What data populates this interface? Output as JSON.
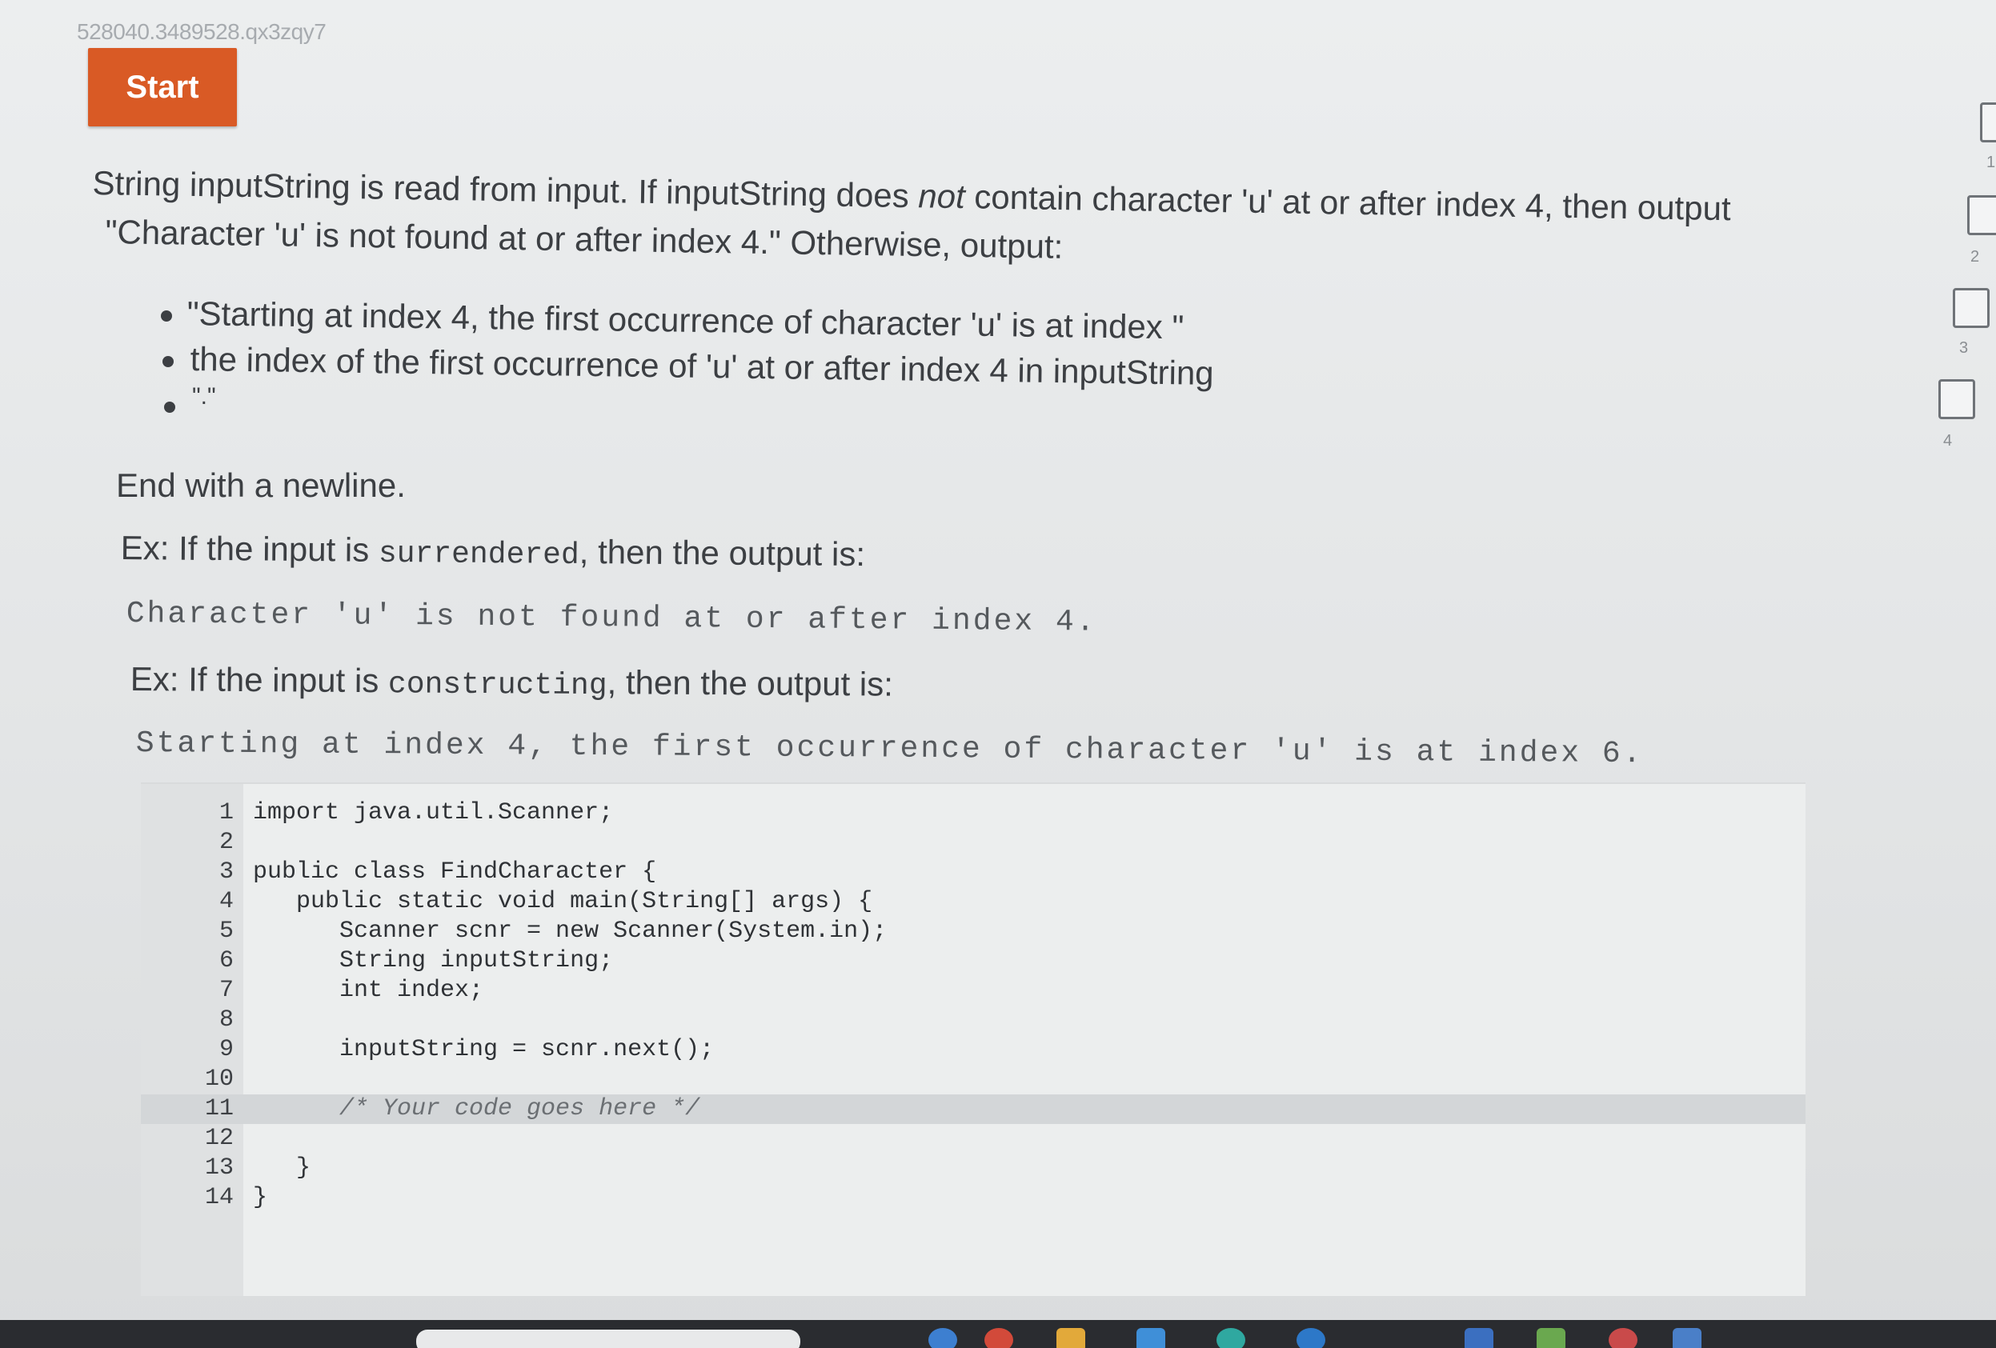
{
  "activity_id": "528040.3489528.qx3zqy7",
  "start_button": {
    "label": "Start",
    "color": "#d95a25"
  },
  "prompt": {
    "line1_a": "String inputString is read from input. If inputString does ",
    "line1_em": "not",
    "line1_b": " contain character 'u' at or after index 4, then output",
    "line2": "\"Character 'u' is not found at or after index 4.\" Otherwise, output:",
    "bullets": [
      "\"Starting at index 4, the first occurrence of character 'u' is at index \"",
      "the index of the first occurrence of 'u' at or after index 4 in inputString",
      "\".\""
    ],
    "end_note": "End with a newline."
  },
  "examples": [
    {
      "prefix": "Ex: If the input is ",
      "input": "surrendered",
      "suffix": ", then the output is:",
      "output": "Character 'u' is not found at or after index 4."
    },
    {
      "prefix": "Ex: If the input is ",
      "input": "constructing",
      "suffix": ", then the output is:",
      "output": "Starting at index 4, the first occurrence of character 'u' is at index 6."
    }
  ],
  "code_editor": {
    "lines": [
      {
        "num": "1",
        "code": "import java.util.Scanner;"
      },
      {
        "num": "2",
        "code": ""
      },
      {
        "num": "3",
        "code": "public class FindCharacter {"
      },
      {
        "num": "4",
        "code": "   public static void main(String[] args) {"
      },
      {
        "num": "5",
        "code": "      Scanner scnr = new Scanner(System.in);"
      },
      {
        "num": "6",
        "code": "      String inputString;"
      },
      {
        "num": "7",
        "code": "      int index;"
      },
      {
        "num": "8",
        "code": ""
      },
      {
        "num": "9",
        "code": "      inputString = scnr.next();"
      },
      {
        "num": "10",
        "code": ""
      },
      {
        "num": "11",
        "code": "      /* Your code goes here */"
      },
      {
        "num": "12",
        "code": ""
      },
      {
        "num": "13",
        "code": "   }"
      },
      {
        "num": "14",
        "code": "}"
      }
    ],
    "active_line": 11
  },
  "progress_levels": [
    "1",
    "2",
    "3",
    "4"
  ]
}
